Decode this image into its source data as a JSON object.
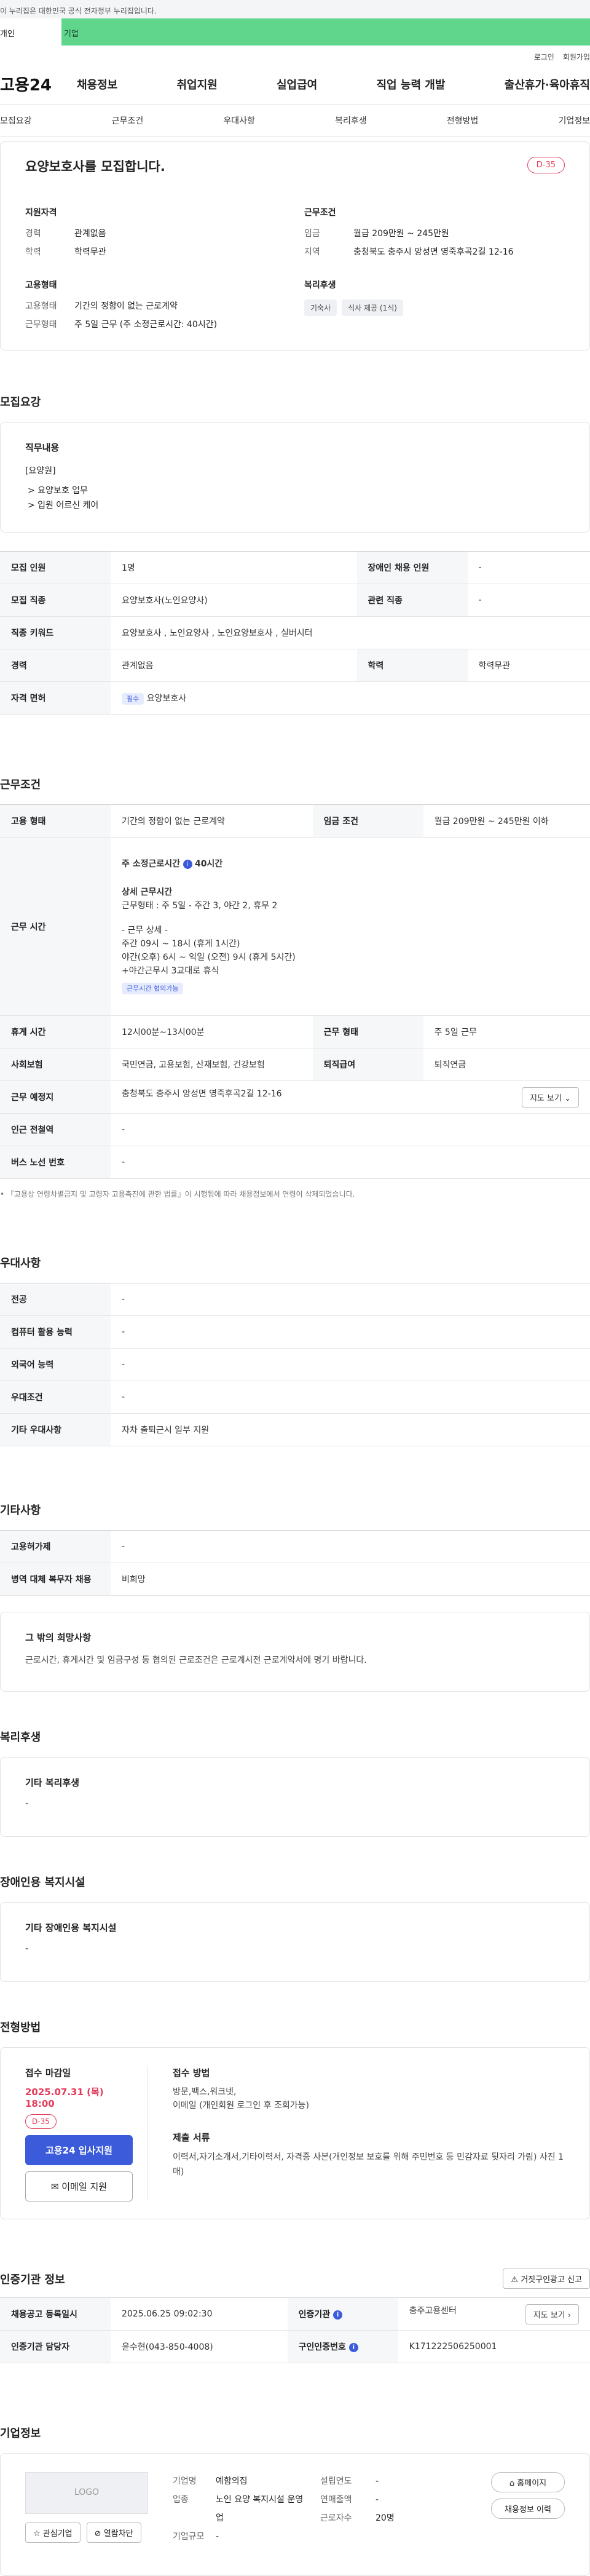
{
  "gov_banner": "이 누리집은 대한민국 공식 전자정부 누리집입니다.",
  "top_tabs": [
    "개인",
    "기업"
  ],
  "utility": [
    "로그인",
    "회원가입"
  ],
  "logo": "고용24",
  "gnb": [
    "채용정보",
    "취업지원",
    "실업급여",
    "직업 능력 개발",
    "출산휴가·육아휴직"
  ],
  "subnav": [
    "모집요강",
    "근무조건",
    "우대사항",
    "복리후생",
    "전형방법",
    "기업정보"
  ],
  "summary": {
    "title": "요양보호사를 모집합니다.",
    "dday": "D-35",
    "qual_title": "지원자격",
    "qual": [
      {
        "k": "경력",
        "v": "관계없음"
      },
      {
        "k": "학력",
        "v": "학력무관"
      }
    ],
    "cond_title": "근무조건",
    "cond": [
      {
        "k": "임금",
        "v": "월급 209만원 ~ 245만원"
      },
      {
        "k": "지역",
        "v": "충청북도 충주시 앙성면 영죽후곡2길 12-16"
      }
    ],
    "emp_title": "고용형태",
    "emp": [
      {
        "k": "고용형태",
        "v": "기간의 정함이 없는 근로계약"
      },
      {
        "k": "근무형태",
        "v": "주 5일 근무 (주 소정근로시간: 40시간)"
      }
    ],
    "welfare_title": "복리후생",
    "welfare_chips": [
      "기숙사",
      "식사 제공 (1식)"
    ]
  },
  "recruit": {
    "title": "모집요강",
    "duty_title": "직무내용",
    "duty_lines": [
      "[요양원]",
      "> 요양보호 업무",
      "> 입원 어르신 케어"
    ],
    "rows": [
      [
        {
          "k": "모집 인원",
          "v": "1명"
        },
        {
          "k": "장애인 채용 인원",
          "v": "-"
        }
      ],
      [
        {
          "k": "모집 직종",
          "v": "요양보호사(노인요양사)"
        },
        {
          "k": "관련 직종",
          "v": "-"
        }
      ],
      [
        {
          "k": "직종 키워드",
          "v": "요양보호사 , 노인요양사 , 노인요양보호사 , 실버시터"
        }
      ],
      [
        {
          "k": "경력",
          "v": "관계없음"
        },
        {
          "k": "학력",
          "v": "학력무관"
        }
      ]
    ],
    "license_k": "자격 면허",
    "license_tag": "필수",
    "license_v": "요양보호사"
  },
  "work": {
    "title": "근무조건",
    "emp_k": "고용 형태",
    "emp_v": "기간의 정함이 없는 근로계약",
    "wage_k": "임금 조건",
    "wage_v": "월급 209만원 ~ 245만원 이하",
    "time_k": "근무 시간",
    "time_lines": [
      "주 소정근로시간",
      "40시간",
      "상세 근무시간",
      "근무형태 : 주 5일 - 주간 3, 야간 2, 휴무 2",
      "- 근무 상세 -",
      "주간  09시 ~ 18시 (휴게 1시간)",
      "야간(오후) 6시 ~ 익일 (오전) 9시 (휴게 5시간)",
      "+야간근무시 3교대로 휴식"
    ],
    "time_tag": "근무시간 협의가능",
    "rows2": [
      [
        {
          "k": "휴게 시간",
          "v": "12시00분~13시00분"
        },
        {
          "k": "근무 형태",
          "v": "주 5일 근무"
        }
      ],
      [
        {
          "k": "사회보험",
          "v": "국민연금, 고용보험, 산재보험, 건강보험"
        },
        {
          "k": "퇴직급여",
          "v": "퇴직연금"
        }
      ]
    ],
    "place_k": "근무 예정지",
    "place_v": "충청북도 충주시 앙성면 영죽후곡2길 12-16",
    "map_btn": "지도 보기",
    "subway_k": "인근 전철역",
    "subway_v": "-",
    "bus_k": "버스 노선 번호",
    "bus_v": "-",
    "footnote": "『고용상 연령차별금지 및 고령자 고용촉진에 관한 법률』이 시행됨에 따라 채용정보에서 연령이 삭제되었습니다."
  },
  "prefer": {
    "title": "우대사항",
    "rows": [
      {
        "k": "전공",
        "v": "-"
      },
      {
        "k": "컴퓨터 활용 능력",
        "v": "-"
      },
      {
        "k": "외국어 능력",
        "v": "-"
      },
      {
        "k": "우대조건",
        "v": "-"
      },
      {
        "k": "기타 우대사항",
        "v": "자차 출퇴근시 일부 지원"
      }
    ]
  },
  "etc": {
    "title": "기타사항",
    "rows": [
      {
        "k": "고용허가제",
        "v": "-"
      },
      {
        "k": "병역 대체 복무자 채용",
        "v": "비희망"
      }
    ],
    "card_title": "그 밖의 희망사항",
    "card_text": "근로시간, 휴게시간 및 임금구성 등 협의된 근로조건은 근로계시전 근로계약서에 명기 바랍니다."
  },
  "benefit": {
    "title": "복리후생",
    "card_title": "기타 복리후생",
    "card_text": "-"
  },
  "disabled": {
    "title": "장애인용 복지시설",
    "card_title": "기타 장애인용 복지시설",
    "card_text": "-"
  },
  "selection": {
    "title": "전형방법",
    "deadline_label": "접수 마감일",
    "deadline": "2025.07.31 (목) 18:00",
    "dday": "D-35",
    "apply_btn": "고용24 입사지원",
    "email_btn": "이메일 지원",
    "method_title": "접수 방법",
    "method_lines": [
      "방문,팩스,워크넷,",
      "이메일 (개인회원 로그인 후 조회가능)"
    ],
    "docs_title": "제출 서류",
    "docs_text": "이력서,자기소개서,기타이력서, 자격증 사본(개인정보 보호를 위해 주민번호 등 민감자료 뒷자리 가림) 사진 1매)"
  },
  "agency": {
    "title": "인증기관 정보",
    "report_btn": "거짓구인광고 신고",
    "reg_k": "채용공고 등록일시",
    "reg_v": "2025.06.25 09:02:30",
    "org_k": "인증기관",
    "org_v": "충주고용센터",
    "map_btn": "지도 보기",
    "mgr_k": "인증기관 담당자",
    "mgr_v": "윤수현(043-850-4008)",
    "no_k": "구인인증번호",
    "no_v": "K171222506250001"
  },
  "company": {
    "title": "기업정보",
    "logo_text": "LOGO",
    "fav_btn": "관심기업",
    "block_btn": "열람차단",
    "fields_l": [
      {
        "k": "기업명",
        "v": "예함의집"
      },
      {
        "k": "업종",
        "v": "노인 요양 복지시설 운영업"
      },
      {
        "k": "기업규모",
        "v": "-"
      }
    ],
    "fields_r": [
      {
        "k": "설립연도",
        "v": "-"
      },
      {
        "k": "연매출액",
        "v": "-"
      },
      {
        "k": "근로자수",
        "v": "20명"
      }
    ],
    "home_btn": "홈페이지",
    "jobs_btn": "채용정보 이력"
  },
  "colors": {
    "accent": "#3b5bdb",
    "dday": "#e23b5a",
    "tab_green": "#5fd68c"
  }
}
